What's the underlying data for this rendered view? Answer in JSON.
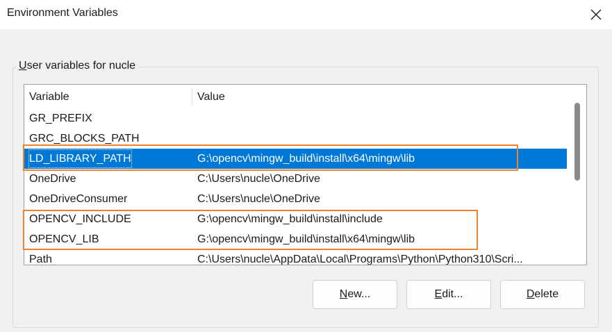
{
  "window": {
    "title": "Environment Variables"
  },
  "group": {
    "label": "User variables for nucle",
    "accesskey_prefix": "U",
    "label_rest": "ser variables for nucle"
  },
  "table": {
    "columns": [
      "Variable",
      "Value"
    ],
    "rows": [
      {
        "variable": "GR_PREFIX",
        "value": ""
      },
      {
        "variable": "GRC_BLOCKS_PATH",
        "value": ""
      },
      {
        "variable": "LD_LIBRARY_PATH",
        "value": "G:\\opencv\\mingw_build\\install\\x64\\mingw\\lib",
        "selected": true
      },
      {
        "variable": "OneDrive",
        "value": "C:\\Users\\nucle\\OneDrive"
      },
      {
        "variable": "OneDriveConsumer",
        "value": "C:\\Users\\nucle\\OneDrive"
      },
      {
        "variable": "OPENCV_INCLUDE",
        "value": "G:\\opencv\\mingw_build\\install\\include"
      },
      {
        "variable": "OPENCV_LIB",
        "value": "G:\\opencv\\mingw_build\\install\\x64\\mingw\\lib"
      },
      {
        "variable": "Path",
        "value": "C:\\Users\\nucle\\AppData\\Local\\Programs\\Python\\Python310\\Scri..."
      }
    ]
  },
  "buttons": {
    "new": {
      "key": "N",
      "rest": "ew..."
    },
    "edit": {
      "key": "E",
      "rest": "dit..."
    },
    "delete": {
      "key": "D",
      "rest": "elete"
    }
  },
  "colors": {
    "selection": "#0078d7",
    "highlight_annotation": "#f0822d"
  },
  "icons": {
    "close": "close-icon"
  }
}
